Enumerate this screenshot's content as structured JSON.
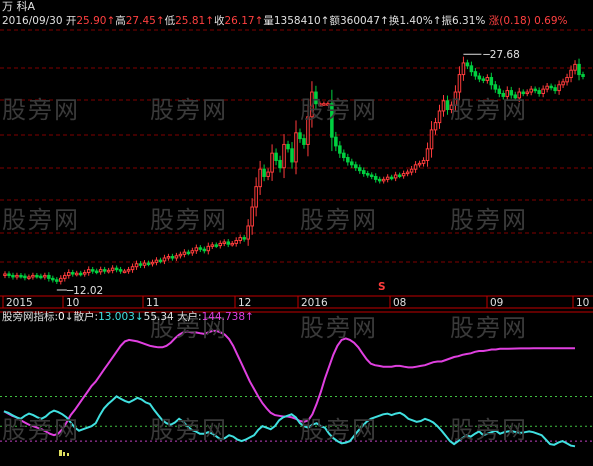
{
  "stock": {
    "name": "万 科A",
    "date": "2016/09/30",
    "open_label": "开",
    "open": "25.90",
    "high_label": "高",
    "high": "27.45",
    "low_label": "低",
    "low": "25.81",
    "close_label": "收",
    "close": "26.17",
    "volume_label": "量",
    "volume": "1358410",
    "amount_label": "额",
    "amount": "360047",
    "turnover_label": "换",
    "turnover": "1.40%",
    "amplitude_label": "振",
    "amplitude": "6.31%",
    "change_label": "涨",
    "change": "(0.18)",
    "change_pct": "0.69%",
    "arrow": "↑"
  },
  "watermark": "股旁网",
  "indicator": {
    "source": "股旁网",
    "index_label": "指标:",
    "index_value": "0",
    "retail_label": "散户:",
    "retail_value": "13.003",
    "mid_value": "55.34",
    "big_label": "大户:",
    "big_value": "144.738",
    "down_arrow": "↓",
    "up_arrow": "↑"
  },
  "colors": {
    "background": "#000000",
    "up": "#ff3c3c",
    "down": "#00d040",
    "retail_line": "#40e0e0",
    "big_line": "#e040e0",
    "grid": "#800000",
    "axis": "#c00000"
  },
  "chart_data": [
    {
      "type": "candlestick",
      "title": "万 科A",
      "x_ticks": [
        "2015",
        "10",
        "11",
        "12",
        "2016",
        "08",
        "09",
        "10"
      ],
      "annotations": [
        {
          "label": "27.68",
          "kind": "period_high"
        },
        {
          "label": "12.02",
          "kind": "period_low"
        },
        {
          "label": "S",
          "kind": "signal"
        }
      ],
      "ylim": [
        11.5,
        29.5
      ],
      "close": [
        12.6,
        12.5,
        12.4,
        12.5,
        12.45,
        12.35,
        12.4,
        12.5,
        12.45,
        12.4,
        12.5,
        12.3,
        12.2,
        12.1,
        12.3,
        12.5,
        12.7,
        12.6,
        12.65,
        12.6,
        12.7,
        12.9,
        12.8,
        12.75,
        12.9,
        12.8,
        12.85,
        13.0,
        12.9,
        12.8,
        12.8,
        12.9,
        13.1,
        13.3,
        13.2,
        13.35,
        13.3,
        13.4,
        13.55,
        13.5,
        13.7,
        13.8,
        13.7,
        13.85,
        13.95,
        14.1,
        14.05,
        14.2,
        14.4,
        14.3,
        14.2,
        14.5,
        14.6,
        14.55,
        14.7,
        14.8,
        14.65,
        14.7,
        14.9,
        15.1,
        15.0,
        15.9,
        17.2,
        18.6,
        19.8,
        19.3,
        19.6,
        20.9,
        20.4,
        19.9,
        21.5,
        21.2,
        20.3,
        22.3,
        21.9,
        21.5,
        23.4,
        25.1,
        24.3,
        24.3,
        24.3,
        24.3,
        22.0,
        21.4,
        20.9,
        20.6,
        20.3,
        20.1,
        19.9,
        19.7,
        19.5,
        19.4,
        19.3,
        19.1,
        19.0,
        19.1,
        19.25,
        19.2,
        19.4,
        19.35,
        19.5,
        19.6,
        19.8,
        20.1,
        20.2,
        20.4,
        21.2,
        22.5,
        23.0,
        23.8,
        24.5,
        23.9,
        24.2,
        25.1,
        26.3,
        27.1,
        26.9,
        26.5,
        26.2,
        26.0,
        25.9,
        26.1,
        25.6,
        25.3,
        25.0,
        24.8,
        25.2,
        24.9,
        24.7,
        25.1,
        25.0,
        25.1,
        25.3,
        25.2,
        25.0,
        25.3,
        25.5,
        25.4,
        25.2,
        25.6,
        25.8,
        26.1,
        26.6,
        27.0,
        26.3,
        26.17
      ]
    },
    {
      "type": "line",
      "series_names": [
        "散户",
        "大户"
      ],
      "ylim": [
        0,
        180
      ],
      "retail": [
        60,
        58,
        55,
        52,
        50,
        54,
        57,
        55,
        52,
        50,
        53,
        58,
        61,
        59,
        56,
        52,
        45,
        38,
        34,
        36,
        38,
        40,
        44,
        55,
        64,
        70,
        75,
        80,
        77,
        74,
        72,
        75,
        78,
        76,
        72,
        70,
        62,
        55,
        48,
        44,
        42,
        45,
        50,
        46,
        40,
        35,
        33,
        30,
        30,
        32,
        30,
        26,
        22,
        24,
        28,
        26,
        22,
        20,
        22,
        25,
        28,
        35,
        40,
        38,
        36,
        40,
        48,
        52,
        54,
        56,
        52,
        44,
        40,
        38,
        42,
        44,
        40,
        38,
        30,
        24,
        20,
        17,
        18,
        20,
        27,
        34,
        40,
        46,
        50,
        52,
        54,
        56,
        57,
        55,
        57,
        58,
        55,
        50,
        48,
        46,
        47,
        50,
        48,
        45,
        40,
        34,
        27,
        20,
        16,
        20,
        24,
        28,
        26,
        30,
        33,
        28,
        30,
        32,
        34,
        30,
        32,
        33,
        33,
        32,
        31,
        32,
        33,
        32,
        30,
        28,
        22,
        16,
        15,
        18,
        20,
        17,
        14,
        13.003
      ],
      "big": [
        60,
        57,
        54,
        52,
        48,
        45,
        42,
        40,
        38,
        36,
        33,
        30,
        28,
        30,
        36,
        45,
        55,
        62,
        70,
        78,
        86,
        94,
        100,
        108,
        116,
        124,
        132,
        140,
        148,
        154,
        156,
        155,
        154,
        152,
        150,
        148,
        147,
        146,
        146,
        148,
        152,
        158,
        163,
        166,
        167,
        166,
        166,
        165,
        164,
        166,
        168,
        168,
        166,
        163,
        157,
        148,
        136,
        124,
        112,
        100,
        90,
        80,
        71,
        64,
        58,
        55,
        54,
        53,
        53,
        52,
        50,
        47,
        46,
        48,
        56,
        70,
        86,
        104,
        120,
        136,
        148,
        156,
        158,
        156,
        152,
        146,
        138,
        130,
        124,
        122,
        121,
        120,
        120,
        120,
        121,
        121,
        120,
        119,
        119,
        120,
        121,
        122,
        124,
        126,
        127,
        127,
        129,
        131,
        133,
        134,
        136,
        137,
        138,
        140,
        141,
        141,
        142,
        143,
        143,
        144,
        144,
        144.2,
        144.3,
        144.4,
        144.5,
        144.6,
        144.6,
        144.7,
        144.738,
        144.738,
        144.738,
        144.738,
        144.738,
        144.738,
        144.738,
        144.738,
        144.738,
        144.738
      ],
      "reference_lines": [
        20,
        40,
        80
      ]
    }
  ]
}
